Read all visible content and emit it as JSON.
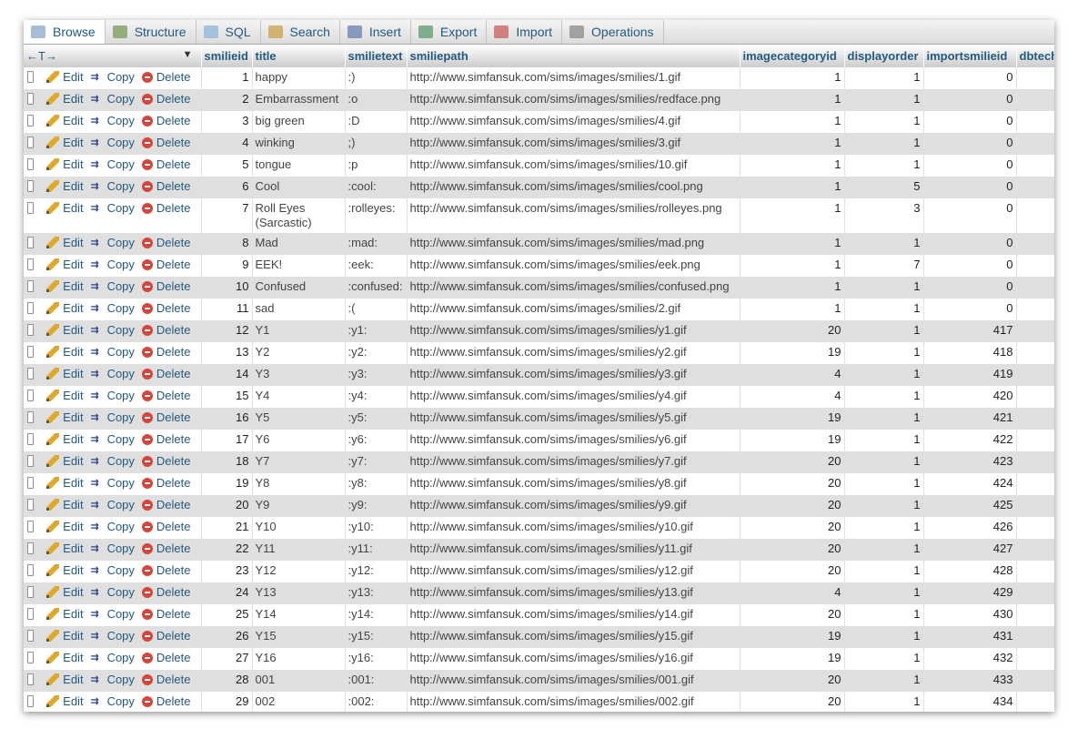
{
  "tabs": [
    {
      "label": "Browse",
      "icon": "browse-icon"
    },
    {
      "label": "Structure",
      "icon": "structure-icon"
    },
    {
      "label": "SQL",
      "icon": "sql-icon"
    },
    {
      "label": "Search",
      "icon": "search-icon"
    },
    {
      "label": "Insert",
      "icon": "insert-icon"
    },
    {
      "label": "Export",
      "icon": "export-icon"
    },
    {
      "label": "Import",
      "icon": "import-icon"
    },
    {
      "label": "Operations",
      "icon": "operations-icon"
    }
  ],
  "table": {
    "arrows_label": "←T→",
    "action_labels": {
      "edit": "Edit",
      "copy": "Copy",
      "delete": "Delete"
    },
    "columns": [
      "smilieid",
      "title",
      "smilietext",
      "smiliepath",
      "imagecategoryid",
      "displayorder",
      "importsmilieid",
      "dbtech"
    ],
    "rows": [
      [
        "1",
        "happy",
        ":)",
        "http://www.simfansuk.com/sims/images/smilies/1.gif",
        "1",
        "1",
        "0"
      ],
      [
        "2",
        "Embarrassment",
        ":o",
        "http://www.simfansuk.com/sims/images/smilies/redface.png",
        "1",
        "1",
        "0"
      ],
      [
        "3",
        "big green",
        ":D",
        "http://www.simfansuk.com/sims/images/smilies/4.gif",
        "1",
        "1",
        "0"
      ],
      [
        "4",
        "winking",
        ";)",
        "http://www.simfansuk.com/sims/images/smilies/3.gif",
        "1",
        "1",
        "0"
      ],
      [
        "5",
        "tongue",
        ":p",
        "http://www.simfansuk.com/sims/images/smilies/10.gif",
        "1",
        "1",
        "0"
      ],
      [
        "6",
        "Cool",
        ":cool:",
        "http://www.simfansuk.com/sims/images/smilies/cool.png",
        "1",
        "5",
        "0"
      ],
      [
        "7",
        "Roll Eyes\n(Sarcastic)",
        ":rolleyes:",
        "http://www.simfansuk.com/sims/images/smilies/rolleyes.png",
        "1",
        "3",
        "0"
      ],
      [
        "8",
        "Mad",
        ":mad:",
        "http://www.simfansuk.com/sims/images/smilies/mad.png",
        "1",
        "1",
        "0"
      ],
      [
        "9",
        "EEK!",
        ":eek:",
        "http://www.simfansuk.com/sims/images/smilies/eek.png",
        "1",
        "7",
        "0"
      ],
      [
        "10",
        "Confused",
        ":confused:",
        "http://www.simfansuk.com/sims/images/smilies/confused.png",
        "1",
        "1",
        "0"
      ],
      [
        "11",
        "sad",
        ":(",
        "http://www.simfansuk.com/sims/images/smilies/2.gif",
        "1",
        "1",
        "0"
      ],
      [
        "12",
        "Y1",
        ":y1:",
        "http://www.simfansuk.com/sims/images/smilies/y1.gif",
        "20",
        "1",
        "417"
      ],
      [
        "13",
        "Y2",
        ":y2:",
        "http://www.simfansuk.com/sims/images/smilies/y2.gif",
        "19",
        "1",
        "418"
      ],
      [
        "14",
        "Y3",
        ":y3:",
        "http://www.simfansuk.com/sims/images/smilies/y3.gif",
        "4",
        "1",
        "419"
      ],
      [
        "15",
        "Y4",
        ":y4:",
        "http://www.simfansuk.com/sims/images/smilies/y4.gif",
        "4",
        "1",
        "420"
      ],
      [
        "16",
        "Y5",
        ":y5:",
        "http://www.simfansuk.com/sims/images/smilies/y5.gif",
        "19",
        "1",
        "421"
      ],
      [
        "17",
        "Y6",
        ":y6:",
        "http://www.simfansuk.com/sims/images/smilies/y6.gif",
        "19",
        "1",
        "422"
      ],
      [
        "18",
        "Y7",
        ":y7:",
        "http://www.simfansuk.com/sims/images/smilies/y7.gif",
        "20",
        "1",
        "423"
      ],
      [
        "19",
        "Y8",
        ":y8:",
        "http://www.simfansuk.com/sims/images/smilies/y8.gif",
        "20",
        "1",
        "424"
      ],
      [
        "20",
        "Y9",
        ":y9:",
        "http://www.simfansuk.com/sims/images/smilies/y9.gif",
        "20",
        "1",
        "425"
      ],
      [
        "21",
        "Y10",
        ":y10:",
        "http://www.simfansuk.com/sims/images/smilies/y10.gif",
        "20",
        "1",
        "426"
      ],
      [
        "22",
        "Y11",
        ":y11:",
        "http://www.simfansuk.com/sims/images/smilies/y11.gif",
        "20",
        "1",
        "427"
      ],
      [
        "23",
        "Y12",
        ":y12:",
        "http://www.simfansuk.com/sims/images/smilies/y12.gif",
        "20",
        "1",
        "428"
      ],
      [
        "24",
        "Y13",
        ":y13:",
        "http://www.simfansuk.com/sims/images/smilies/y13.gif",
        "4",
        "1",
        "429"
      ],
      [
        "25",
        "Y14",
        ":y14:",
        "http://www.simfansuk.com/sims/images/smilies/y14.gif",
        "20",
        "1",
        "430"
      ],
      [
        "26",
        "Y15",
        ":y15:",
        "http://www.simfansuk.com/sims/images/smilies/y15.gif",
        "19",
        "1",
        "431"
      ],
      [
        "27",
        "Y16",
        ":y16:",
        "http://www.simfansuk.com/sims/images/smilies/y16.gif",
        "19",
        "1",
        "432"
      ],
      [
        "28",
        "001",
        ":001:",
        "http://www.simfansuk.com/sims/images/smilies/001.gif",
        "20",
        "1",
        "433"
      ],
      [
        "29",
        "002",
        ":002:",
        "http://www.simfansuk.com/sims/images/smilies/002.gif",
        "20",
        "1",
        "434"
      ]
    ]
  }
}
